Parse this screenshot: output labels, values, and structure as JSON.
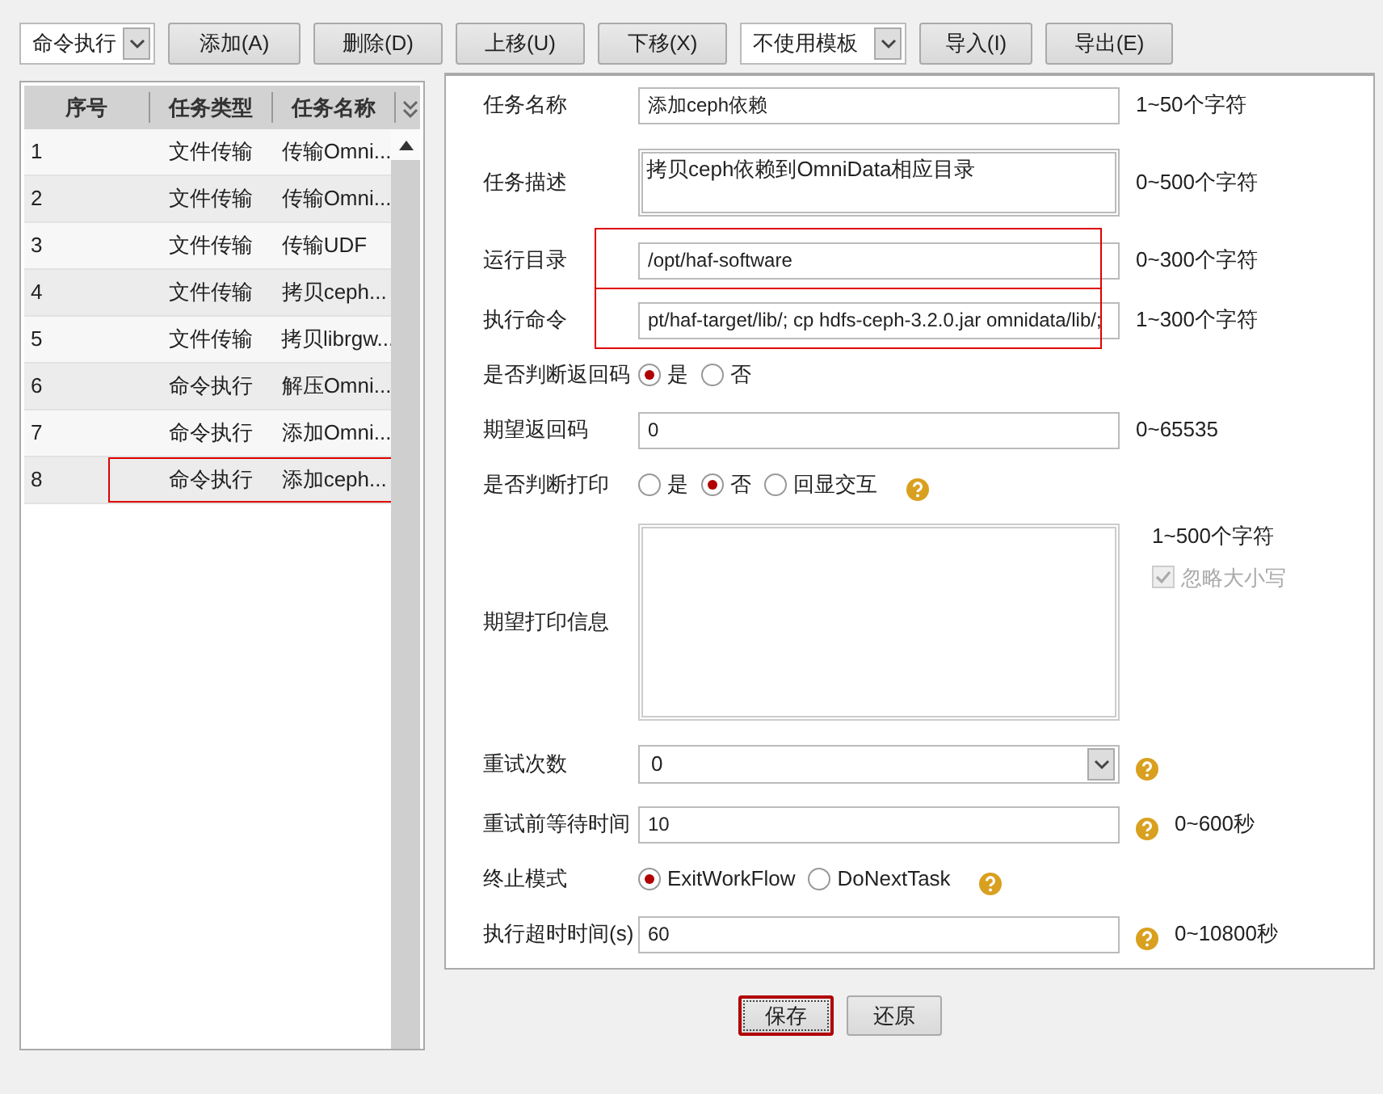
{
  "toolbar": [
    {
      "kind": "select",
      "value": "命令执行"
    },
    {
      "kind": "button",
      "label": "添加(A)"
    },
    {
      "kind": "button",
      "label": "删除(D)"
    },
    {
      "kind": "button",
      "label": "上移(U)"
    },
    {
      "kind": "button",
      "label": "下移(X)"
    },
    {
      "kind": "select",
      "value": "不使用模板"
    },
    {
      "kind": "button",
      "label": "导入(I)"
    },
    {
      "kind": "button",
      "label": "导出(E)"
    }
  ],
  "table": {
    "columns": [
      "序号",
      "任务类型",
      "任务名称"
    ],
    "rows": [
      {
        "cells": [
          "1",
          "文件传输",
          "传输Omni..."
        ],
        "annotated": false
      },
      {
        "cells": [
          "2",
          "文件传输",
          "传输Omni..."
        ],
        "annotated": false
      },
      {
        "cells": [
          "3",
          "文件传输",
          "传输UDF"
        ],
        "annotated": false
      },
      {
        "cells": [
          "4",
          "文件传输",
          "拷贝ceph..."
        ],
        "annotated": false
      },
      {
        "cells": [
          "5",
          "文件传输",
          "拷贝librgw..."
        ],
        "annotated": false
      },
      {
        "cells": [
          "6",
          "命令执行",
          "解压Omni..."
        ],
        "annotated": false
      },
      {
        "cells": [
          "7",
          "命令执行",
          "添加Omni..."
        ],
        "annotated": false
      },
      {
        "cells": [
          "8",
          "命令执行",
          "添加ceph..."
        ],
        "annotated": true
      }
    ]
  },
  "form": {
    "fields": [
      {
        "kind": "input",
        "label": "任务名称",
        "value": "添加ceph依赖",
        "hint": "1~50个字符",
        "annotated": false
      },
      {
        "kind": "textarea",
        "label": "任务描述",
        "value": "拷贝ceph依赖到OmniData相应目录",
        "hint": "0~500个字符"
      },
      {
        "kind": "input",
        "label": "运行目录",
        "value": "/opt/haf-software",
        "hint": "0~300个字符",
        "annotated": true
      },
      {
        "kind": "input",
        "label": "执行命令",
        "value": "pt/haf-target/lib/; cp hdfs-ceph-3.2.0.jar  omnidata/lib/;",
        "hint": "1~300个字符",
        "annotated": true
      },
      {
        "kind": "radio",
        "label": "是否判断返回码",
        "options": [
          {
            "label": "是",
            "selected": true
          },
          {
            "label": "否",
            "selected": false
          }
        ],
        "help": false
      },
      {
        "kind": "input",
        "label": "期望返回码",
        "value": "0",
        "hint": "0~65535",
        "annotated": false
      },
      {
        "kind": "radio",
        "label": "是否判断打印",
        "options": [
          {
            "label": "是",
            "selected": false
          },
          {
            "label": "否",
            "selected": true
          },
          {
            "label": "回显交互",
            "selected": false
          }
        ],
        "help": true
      },
      {
        "kind": "textarea_tall",
        "label": "期望打印信息",
        "hint": "1~500个字符",
        "checkbox": {
          "label": "忽略大小写",
          "checked": true,
          "disabled": true
        }
      },
      {
        "kind": "select",
        "label": "重试次数",
        "value": "0",
        "help": true
      },
      {
        "kind": "input",
        "label": "重试前等待时间",
        "value": "10",
        "hint": "0~600秒",
        "help": true,
        "annotated": false
      },
      {
        "kind": "radio",
        "label": "终止模式",
        "options": [
          {
            "label": "ExitWorkFlow",
            "selected": true
          },
          {
            "label": "DoNextTask",
            "selected": false
          }
        ],
        "help": true
      },
      {
        "kind": "input",
        "label": "执行超时时间(s)",
        "value": "60",
        "hint": "0~10800秒",
        "help": true,
        "annotated": false
      }
    ]
  },
  "actions": [
    {
      "label": "保存",
      "focused": true
    },
    {
      "label": "还原",
      "focused": false
    }
  ]
}
